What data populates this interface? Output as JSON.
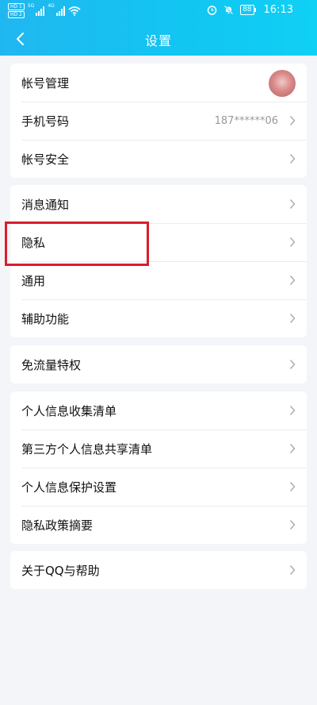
{
  "status_bar": {
    "hd1": "HD 1",
    "hd2": "HD 2",
    "net1": "5G",
    "net2": "4G",
    "battery": "88",
    "time": "16:13"
  },
  "header": {
    "title": "设置",
    "background_color": "#1cbdf1"
  },
  "groups": [
    {
      "items": [
        {
          "label": "帐号管理",
          "has_avatar": true
        },
        {
          "label": "手机号码",
          "value": "187******06"
        },
        {
          "label": "帐号安全"
        }
      ]
    },
    {
      "items": [
        {
          "label": "消息通知"
        },
        {
          "label": "隐私",
          "highlighted": true
        },
        {
          "label": "通用"
        },
        {
          "label": "辅助功能"
        }
      ]
    },
    {
      "items": [
        {
          "label": "免流量特权"
        }
      ]
    },
    {
      "items": [
        {
          "label": "个人信息收集清单"
        },
        {
          "label": "第三方个人信息共享清单"
        },
        {
          "label": "个人信息保护设置"
        },
        {
          "label": "隐私政策摘要"
        }
      ]
    },
    {
      "items": [
        {
          "label": "关于QQ与帮助"
        }
      ]
    }
  ],
  "highlight_color": "#d91e2a"
}
